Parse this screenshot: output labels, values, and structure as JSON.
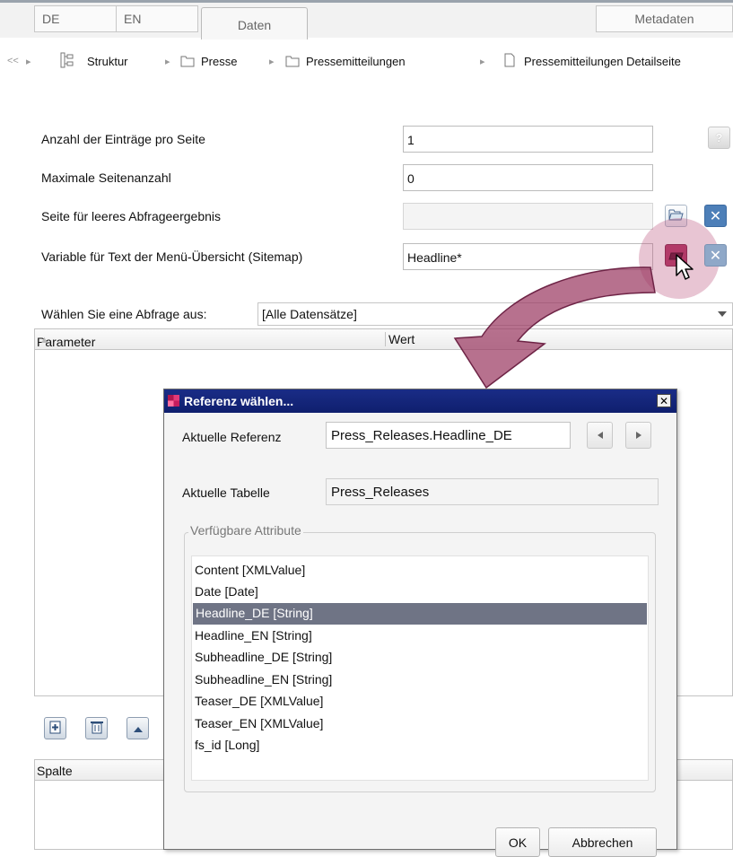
{
  "tabs": {
    "lang_de": "DE",
    "lang_en": "EN",
    "daten": "Daten",
    "metadaten": "Metadaten"
  },
  "breadcrumb": {
    "nav_back": "<<",
    "items": [
      {
        "label": "Struktur",
        "icon": "structure-icon"
      },
      {
        "label": "Presse",
        "icon": "folder-icon"
      },
      {
        "label": "Pressemitteilungen",
        "icon": "folder-icon"
      },
      {
        "label": "Pressemitteilungen Detailseite",
        "icon": "page-icon"
      }
    ]
  },
  "form": {
    "entries_per_page": {
      "label": "Anzahl der Einträge pro Seite",
      "value": "1"
    },
    "max_pages": {
      "label": "Maximale Seitenanzahl",
      "value": "0"
    },
    "empty_result_page": {
      "label": "Seite für leeres Abfrageergebnis",
      "value": ""
    },
    "menu_text_variable": {
      "label": "Variable für Text der Menü-Übersicht (Sitemap)",
      "value": "Headline*"
    },
    "help_label": "?"
  },
  "query": {
    "label": "Wählen Sie eine Abfrage aus:",
    "selected": "[Alle Datensätze]"
  },
  "parameter_table": {
    "col_parameter": "Parameter",
    "col_wert": "Wert"
  },
  "column_table": {
    "col_spalte": "Spalte"
  },
  "dialog": {
    "title": "Referenz wählen...",
    "current_reference_label": "Aktuelle Referenz",
    "current_reference_value": "Press_Releases.Headline_DE",
    "current_table_label": "Aktuelle Tabelle",
    "current_table_value": "Press_Releases",
    "attributes_legend": "Verfügbare Attribute",
    "attributes": [
      "Content [XMLValue]",
      "Date [Date]",
      "Headline_DE [String]",
      "Headline_EN [String]",
      "Subheadline_DE [String]",
      "Subheadline_EN [String]",
      "Teaser_DE [XMLValue]",
      "Teaser_EN [XMLValue]",
      "fs_id [Long]"
    ],
    "selected_index": 2,
    "ok_label": "OK",
    "cancel_label": "Abbrechen"
  },
  "colors": {
    "dialog_title_bg": "#0f1f6e",
    "selection_bg": "#6f7485",
    "highlight_arrow": "#9b3a63",
    "delete_button": "#4d7fb8"
  }
}
